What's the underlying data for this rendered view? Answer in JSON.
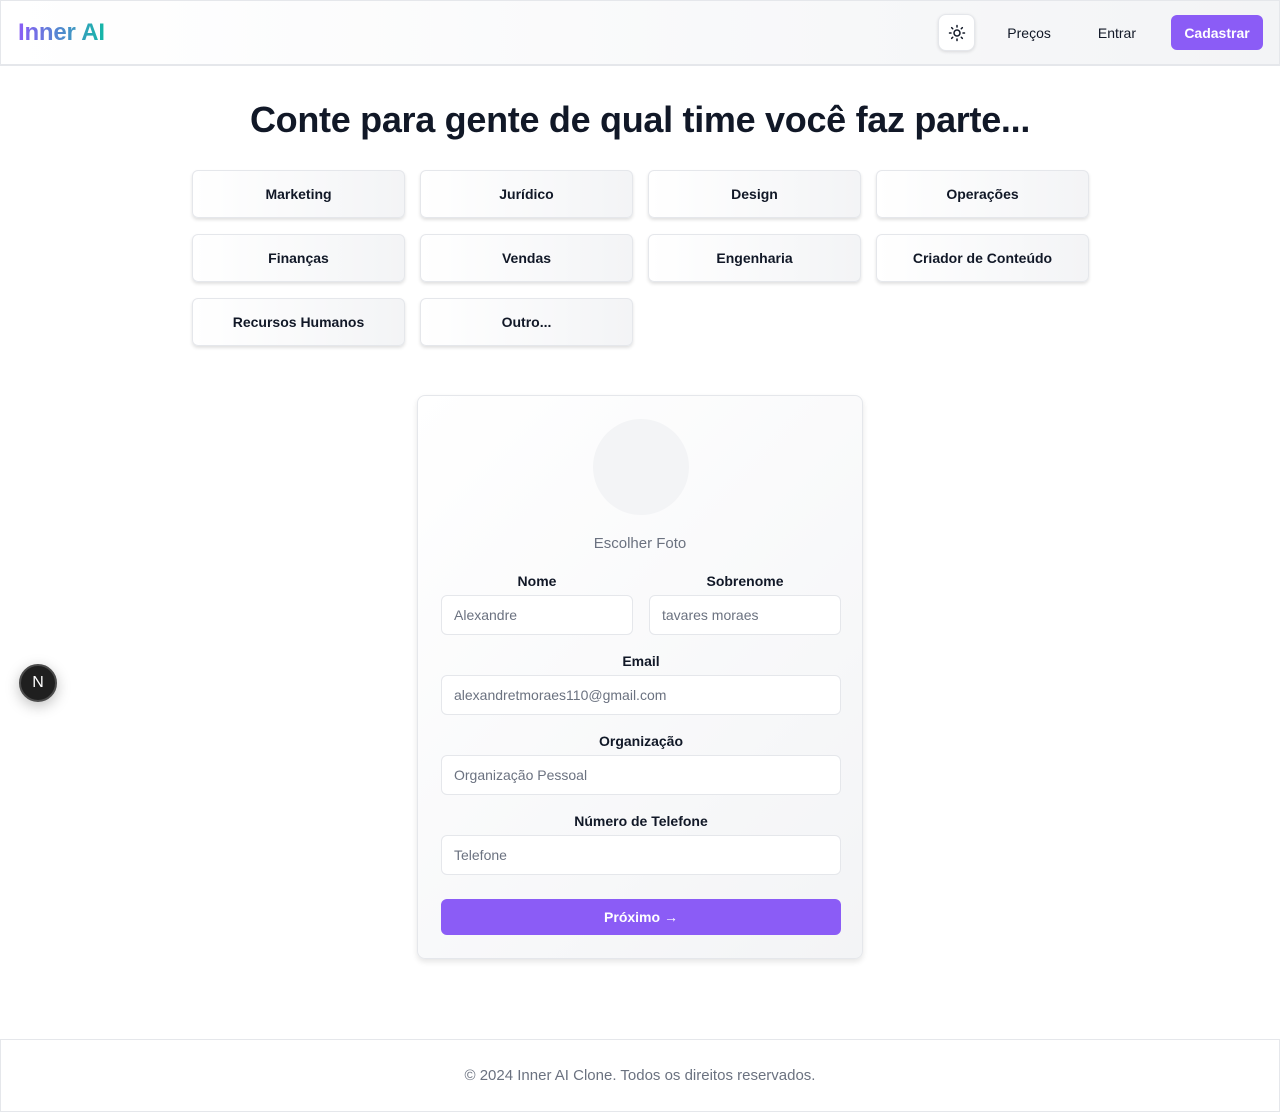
{
  "header": {
    "brand": "Inner AI",
    "theme_icon": "sun-icon",
    "nav": {
      "prices": "Preços",
      "login": "Entrar",
      "signup": "Cadastrar"
    }
  },
  "title": "Conte para gente de qual time você faz parte...",
  "teams": [
    "Marketing",
    "Jurídico",
    "Design",
    "Operações",
    "Finanças",
    "Vendas",
    "Engenharia",
    "Criador de Conteúdo",
    "Recursos Humanos",
    "Outro..."
  ],
  "form": {
    "choose_photo": "Escolher Foto",
    "first_name": {
      "label": "Nome",
      "placeholder": "Alexandre"
    },
    "last_name": {
      "label": "Sobrenome",
      "placeholder": "tavares moraes"
    },
    "email": {
      "label": "Email",
      "placeholder": "alexandretmoraes110@gmail.com"
    },
    "organization": {
      "label": "Organização",
      "placeholder": "Organização Pessoal"
    },
    "phone": {
      "label": "Número de Telefone",
      "placeholder": "Telefone"
    },
    "next_button": "Próximo →"
  },
  "floating_badge": "N",
  "footer": "© 2024 Inner AI Clone. Todos os direitos reservados.",
  "colors": {
    "accent": "#8b5cf6",
    "brand_gradient_end": "#14b8a6"
  }
}
